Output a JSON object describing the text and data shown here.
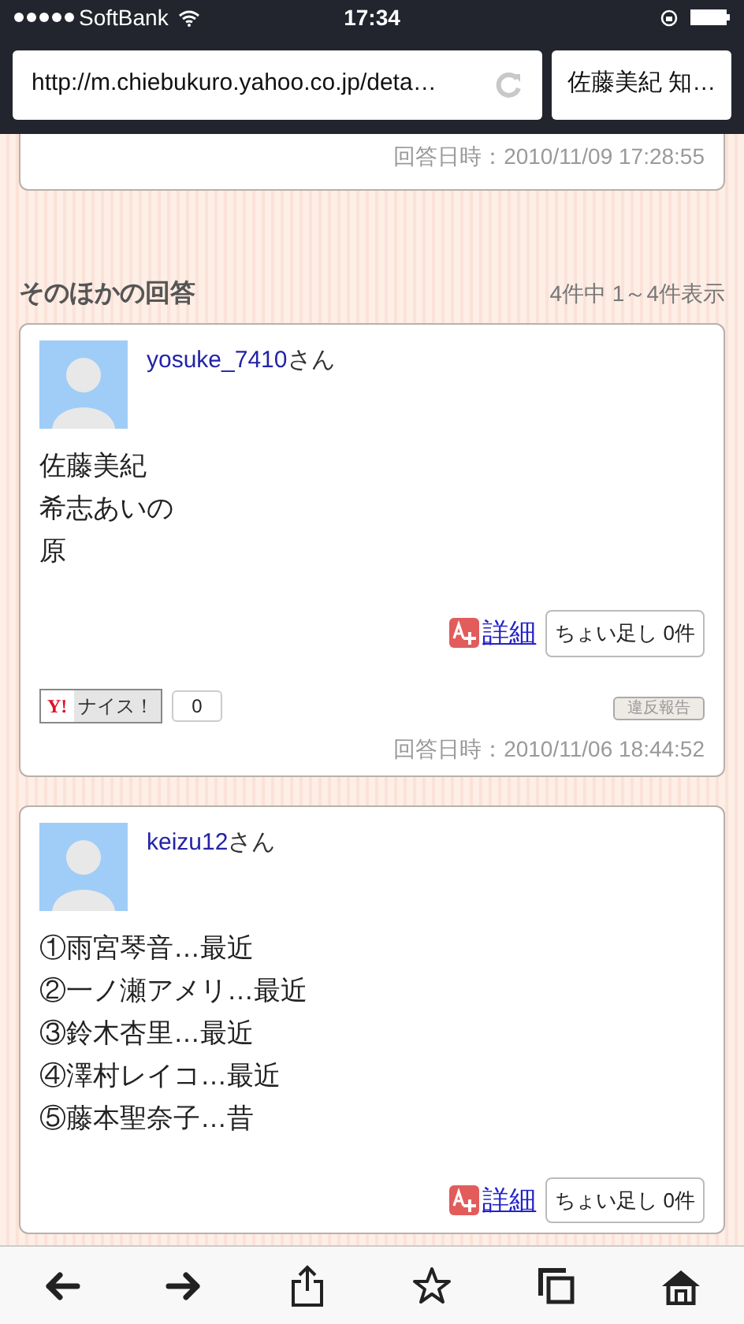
{
  "status_bar": {
    "carrier": "SoftBank",
    "time": "17:34"
  },
  "browser": {
    "url": "http://m.chiebukuro.yahoo.co.jp/deta…",
    "tab_title": "佐藤美紀 知…"
  },
  "previous_answer": {
    "date": "回答日時：2010/11/09 17:28:55"
  },
  "other_answers": {
    "title": "そのほかの回答",
    "count": "4件中 1～4件表示",
    "answers": [
      {
        "user": "yosuke_7410",
        "suffix": "さん",
        "lines": [
          "佐藤美紀",
          "希志あいの",
          "原"
        ],
        "detail": "詳細",
        "addition": "ちょい足し 0件",
        "nice": {
          "logo": "Y!",
          "label": "ナイス！",
          "count": "0"
        },
        "report": "違反報告",
        "date": "回答日時：2010/11/06 18:44:52"
      },
      {
        "user": "keizu12",
        "suffix": "さん",
        "lines": [
          "①雨宮琴音…最近",
          "②一ノ瀬アメリ…最近",
          "③鈴木杏里…最近",
          "④澤村レイコ…最近",
          "⑤藤本聖奈子…昔"
        ],
        "detail": "詳細",
        "addition": "ちょい足し 0件"
      }
    ]
  }
}
